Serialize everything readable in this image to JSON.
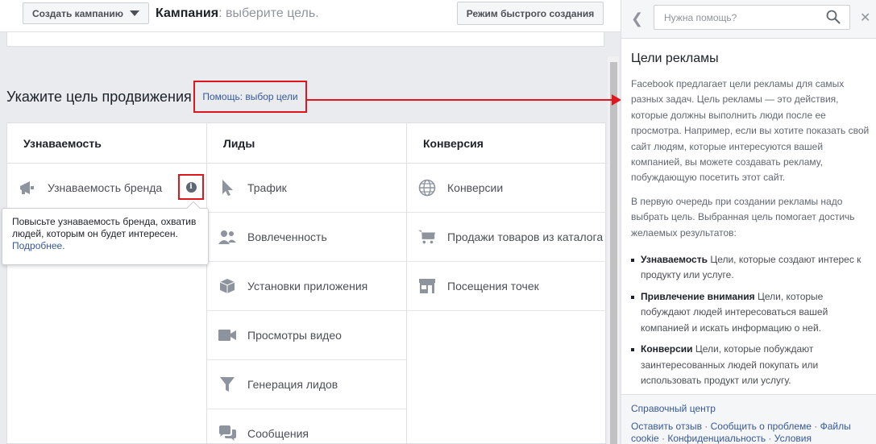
{
  "topbar": {
    "create_label": "Создать кампанию",
    "campaign_label": "Кампания",
    "campaign_hint": ": выберите цель.",
    "quick_mode_label": "Режим быстрого создания"
  },
  "goal": {
    "heading": "Укажите цель продвижения",
    "help_link": "Помощь: выбор цели"
  },
  "columns": {
    "awareness": {
      "header": "Узнаваемость",
      "items": [
        "Узнаваемость бренда"
      ]
    },
    "leads": {
      "header": "Лиды",
      "items": [
        "Трафик",
        "Вовлеченность",
        "Установки приложения",
        "Просмотры видео",
        "Генерация лидов",
        "Сообщения"
      ]
    },
    "conversion": {
      "header": "Конверсия",
      "items": [
        "Конверсии",
        "Продажи товаров из каталога",
        "Посещения точек"
      ]
    }
  },
  "tooltip": {
    "text": "Повысьте узнаваемость бренда, охватив людей, которым он будет интересен. ",
    "link": "Подробнее."
  },
  "help": {
    "search_placeholder": "Нужна помощь?",
    "title": "Цели рекламы",
    "para1": "Facebook предлагает цели рекламы для самых разных задач. Цель рекламы — это действия, которые должны выполнить люди после ее просмотра. Например, если вы хотите показать свой сайт людям, которые интересуются вашей компанией, вы можете создавать рекламу, побуждающую посетить этот сайт.",
    "para2": "В первую очередь при создании рекламы надо выбрать цель. Выбранная цель помогает достичь желаемых результатов:",
    "list": [
      {
        "term": "Узнаваемость",
        "desc": " Цели, которые создают интерес к продукту или услуге."
      },
      {
        "term": "Привлечение внимания",
        "desc": " Цели, которые побуждают людей интересоваться вашей компанией и искать информацию о ней."
      },
      {
        "term": "Конверсии",
        "desc": " Цели, которые побуждают заинтересованных людей покупать или использовать продукт или услугу."
      }
    ],
    "footer": {
      "center": "Справочный центр",
      "link1": "Оставить отзыв",
      "link2": "Сообщить о проблеме",
      "link3": "Файлы cookie",
      "link4": "Конфиденциальность",
      "link5": "Условия",
      "sep": " · "
    }
  },
  "colors": {
    "accent_red": "#e0161f",
    "link_blue": "#365899",
    "icon_gray": "#8d949e"
  }
}
